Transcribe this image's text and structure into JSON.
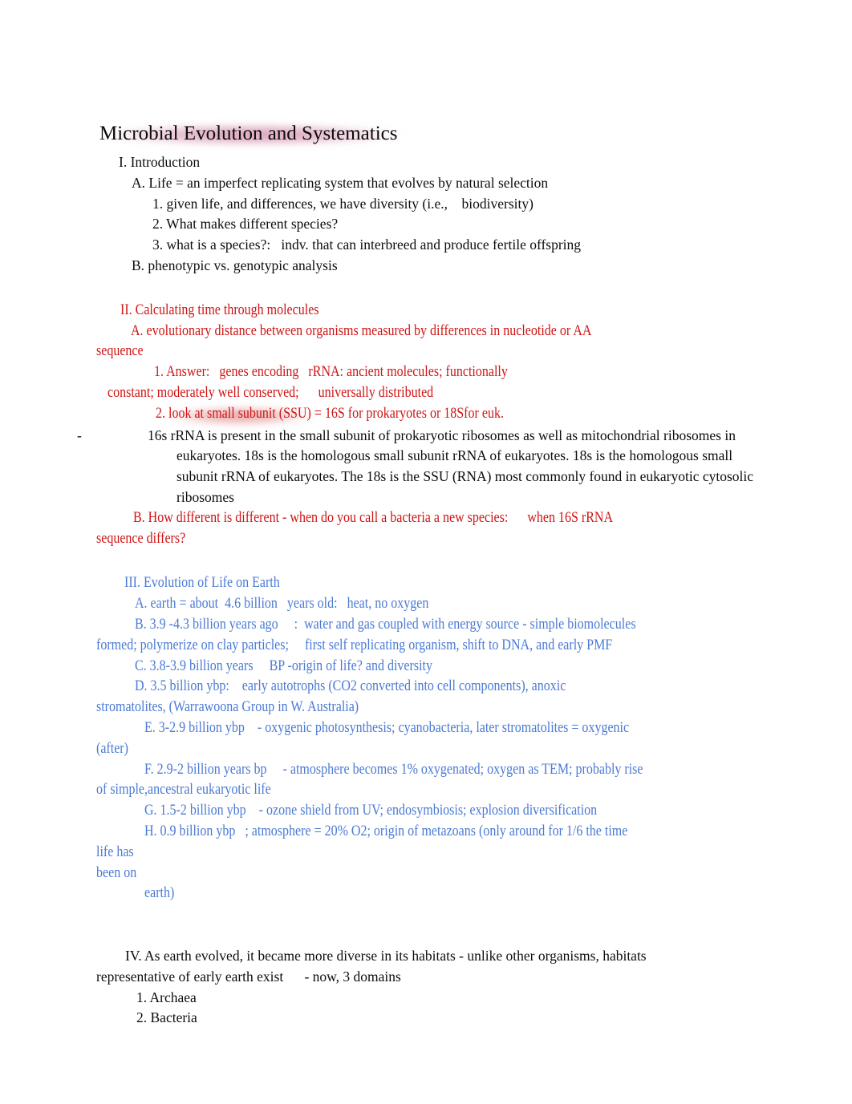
{
  "document": {
    "title": "Microbial Evolution and Systematics",
    "title_highlight_color": "#c56891",
    "body_text_color": "#0d0d0d",
    "red_text_color": "#d01414",
    "blue_text_color": "#4a7ad4",
    "background_color": "#ffffff"
  },
  "section_intro": {
    "heading": "I. Introduction",
    "item_a": "A. Life = an imperfect replicating system that evolves by natural selection",
    "item_a1": "1. given life, and differences, we have diversity (i.e.,    biodiversity)",
    "item_a2": "2. What makes different species?",
    "item_a3": "3. what is a species?:   indv. that can interbreed and produce fertile offspring",
    "item_b": "B. phenotypic vs. genotypic analysis"
  },
  "section_calculating": {
    "heading": "II. Calculating time through molecules",
    "item_a_line1": "A. evolutionary distance between organisms measured by differences in nucleotide or AA",
    "item_a_line2": "sequence",
    "item_a1_line1": "1. Answer:   genes encoding   rRNA: ancient molecules; functionally",
    "item_a1_line2": "constant; moderately well conserved;      universally distributed",
    "item_a2_prefix": "2. ",
    "item_a2_highlighted": "look at small subunit (SSU)",
    "item_a2_suffix": " = 16S for prokaryotes or 18Sfor euk.",
    "note_dash": "-",
    "note_text": "16s rRNA is present in the small subunit of prokaryotic ribosomes as well as mitochondrial ribosomes in eukaryotes. 18s is the homologous small subunit rRNA of eukaryotes. 18s is the homologous small subunit rRNA of eukaryotes. The 18s is the SSU (RNA) most commonly found in eukaryotic cytosolic ribosomes",
    "item_b_line1": "B. How different is different - when do you call a bacteria a new species:      when 16S rRNA",
    "item_b_line2": "sequence differs?"
  },
  "section_evolution": {
    "heading": "III. Evolution of Life on Earth",
    "item_a": "A. earth = about  4.6 billion   years old:   heat, no oxygen",
    "item_b_line1": "B. 3.9 -4.3 billion years ago     :  water and gas coupled with energy source - simple biomolecules",
    "item_b_line2": "formed; polymerize on clay particles;     first self replicating organism, shift to DNA, and early PMF",
    "item_c": "C. 3.8-3.9 billion years     BP -origin of life? and diversity",
    "item_d_line1": "D. 3.5 billion ybp:    early autotrophs (CO2 converted into cell components), anoxic",
    "item_d_line2": "stromatolites, (Warrawoona Group in W. Australia)",
    "item_e_line1": "E. 3-2.9 billion ybp    - oxygenic photosynthesis; cyanobacteria, later stromatolites = oxygenic",
    "item_e_line2": "(after)",
    "item_f_line1": "F. 2.9-2 billion years bp     - atmosphere becomes 1% oxygenated; oxygen as TEM; probably rise",
    "item_f_line2": "of simple,ancestral eukaryotic life",
    "item_g": "G. 1.5-2 billion ybp    - ozone shield from UV; endosymbiosis; explosion diversification",
    "item_h_line1": "H. 0.9 billion ybp   ; atmosphere = 20% O2; origin of metazoans (only around for 1/6 the time",
    "item_h_line2": "life has",
    "item_h_line3": "been on",
    "item_h_line4": "     earth)"
  },
  "section_domains": {
    "heading_line1": "IV. As earth evolved, it became more diverse in its habitats - unlike other organisms, habitats",
    "heading_line2": "representative of early earth exist      - now, 3 domains",
    "item_1": "1. Archaea",
    "item_2": "2. Bacteria"
  }
}
